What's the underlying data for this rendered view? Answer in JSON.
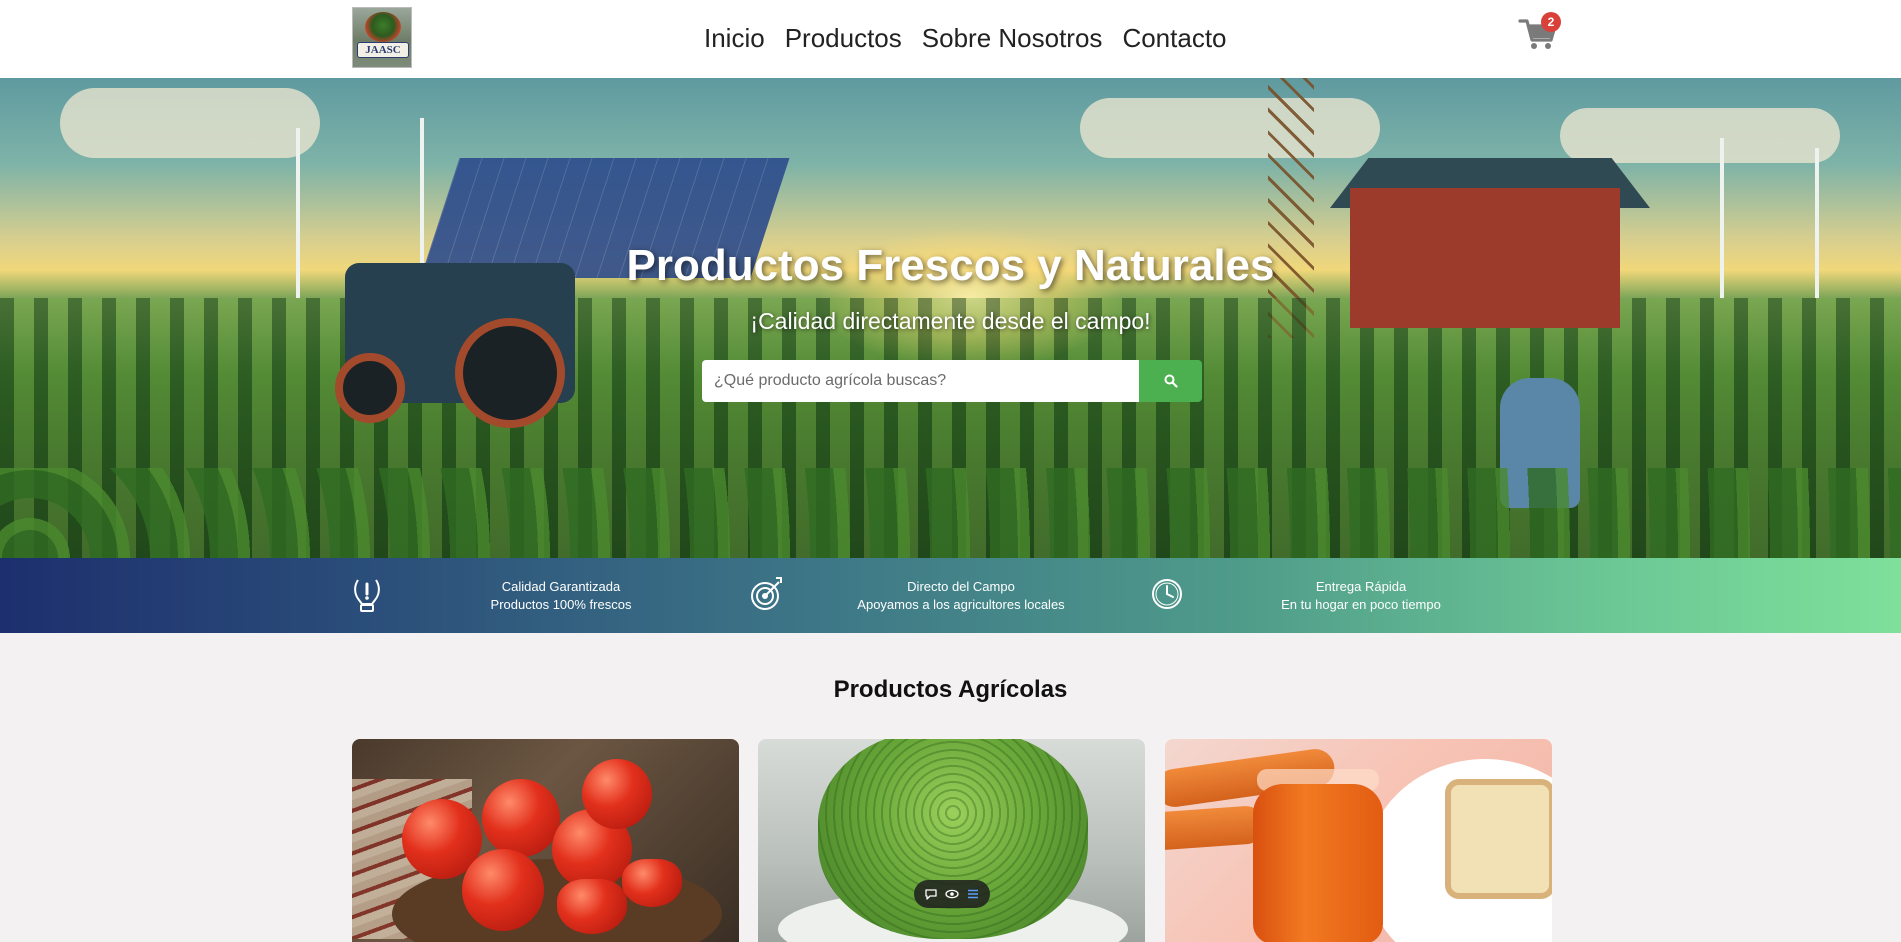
{
  "header": {
    "logo_text": "JAASC",
    "nav": [
      {
        "label": "Inicio"
      },
      {
        "label": "Productos"
      },
      {
        "label": "Sobre Nosotros"
      },
      {
        "label": "Contacto"
      }
    ],
    "cart_count": "2",
    "icons": {
      "cart": "shopping-cart-icon"
    }
  },
  "hero": {
    "title": "Productos Frescos y Naturales",
    "subtitle": "¡Calidad directamente desde el campo!",
    "search_placeholder": "¿Qué producto agrícola buscas?",
    "search_icon": "search-icon"
  },
  "features": [
    {
      "icon": "quality-icon",
      "title": "Calidad Garantizada",
      "text": "Productos 100% frescos"
    },
    {
      "icon": "target-icon",
      "title": "Directo del Campo",
      "text": "Apoyamos a los agricultores locales"
    },
    {
      "icon": "clock-icon",
      "title": "Entrega Rápida",
      "text": "En tu hogar en poco tiempo"
    }
  ],
  "products": {
    "title": "Productos Agrícolas"
  },
  "colors": {
    "accent": "#4caf50",
    "badge": "#d9403a",
    "band_start": "#1d2f6e",
    "band_end": "#7ee09a"
  }
}
